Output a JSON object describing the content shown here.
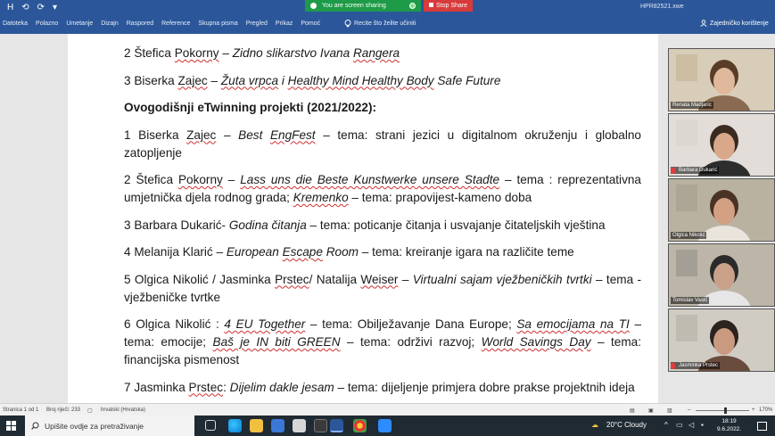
{
  "titlebar": {
    "qat": [
      "H",
      "⟲",
      "⟳",
      "▾"
    ],
    "doc_title": "HPR82521.xwe",
    "sharing_text": "You are screen sharing",
    "stop_share": "Stop Share"
  },
  "ribbon": {
    "tabs": [
      "Datoteka",
      "Polazno",
      "Umetanje",
      "Dizajn",
      "Raspored",
      "Reference",
      "Skupna pisma",
      "Pregled",
      "Prikaz",
      "Pomoć"
    ],
    "tell_me": "Recite što želite učiniti",
    "coauthoring": "Zajedničko korištenje"
  },
  "document": {
    "p1": {
      "num": "2 ",
      "name": "Štefica Pokorny",
      "dash": " – ",
      "title": "Zidno slikarstvo Ivana Rangera"
    },
    "p2": {
      "num": "3 ",
      "name": "Biserka Zajec",
      "dash": " – ",
      "title": "Žuta vrpca i Healthy Mind Healthy Body Safe Future"
    },
    "heading": "Ovogodišnji eTwinning projekti (2021/2022):",
    "p3": {
      "pre": "1 Biserka Zajec – ",
      "title": "Best EngFest",
      "post": " – tema: strani jezici u digitalnom okruženju i globalno zatopljenje"
    },
    "p4": {
      "pre": "2 Štefica Pokorny – ",
      "title": "Lass uns die Beste Kunstwerke unsere Stadte",
      "mid": " – tema : reprezentativna umjetnička djela rodnog grada; ",
      "title2": "Kremenko",
      "post": " – tema: prapovijest-kameno doba"
    },
    "p5": {
      "pre": "3 Barbara Dukarić- ",
      "title": "Godina čitanja",
      "post": " – tema: poticanje čitanja i usvajanje čitateljskih vještina"
    },
    "p6": {
      "pre": "4 Melanija Klarić – ",
      "title": "European Escape Room",
      "post": " – tema: kreiranje igara na različite teme"
    },
    "p7": {
      "pre": "5 Olgica Nikolić / Jasminka Prstec/ Natalija Weiser – ",
      "title": "Virtualni sajam vježbeničkih tvrtki",
      "post": " – tema -vježbeničke tvrtke"
    },
    "p8": {
      "pre": "6 Olgica Nikolić : ",
      "t1": "4 EU Together",
      "m1": " – tema: Obilježavanje Dana Europe; ",
      "t2": "Sa emocijama na TI",
      "m2": " – tema: emocije; ",
      "t3": "Baš je IN biti GREEN",
      "m3": " – tema: održivi razvoj; ",
      "t4": "World Savings Day",
      "post": " – tema: financijska pismenost"
    },
    "p9": {
      "pre": "7 Jasminka Prstec: ",
      "title": "Dijelim dakle jesam",
      "post": " – tema: dijeljenje primjera dobre prakse projektnih ideja"
    }
  },
  "participants": [
    {
      "name": "Renata Madjaric",
      "bg": "#c9b79a",
      "wall": "#d8cdb8",
      "hair": "#5a3d28",
      "skin": "#e0b89c",
      "shirt": "#8a6a50",
      "muted": false
    },
    {
      "name": "Barbara Dukarić",
      "bg": "#d9d4cf",
      "wall": "#e2ddd8",
      "hair": "#3b2a1f",
      "skin": "#d9a88a",
      "shirt": "#2d2d2d",
      "muted": true
    },
    {
      "name": "Olgica Nikolić",
      "bg": "#a8a090",
      "wall": "#b9b2a0",
      "hair": "#4a3224",
      "skin": "#d4a084",
      "shirt": "#e9e4dc",
      "muted": false
    },
    {
      "name": "Tomislav Vasić",
      "bg": "#9a958c",
      "wall": "#bdb6a8",
      "hair": "#2a2a2a",
      "skin": "#c9a088",
      "shirt": "#e6e6e6",
      "muted": false
    },
    {
      "name": "Jasminka Prstec",
      "bg": "#b8b3aa",
      "wall": "#d0ccc4",
      "hair": "#2b2320",
      "skin": "#c99a80",
      "shirt": "#6a4c3c",
      "muted": true
    }
  ],
  "statusbar": {
    "page": "Stranica 1 od 1",
    "words": "Broj riječi: 233",
    "lang": "hrvatski (Hrvatska)",
    "zoom": "170%"
  },
  "taskbar": {
    "search_placeholder": "Upišite ovdje za pretraživanje",
    "weather": "20°C  Cloudy",
    "time": "18:19",
    "date": "9.6.2022."
  }
}
